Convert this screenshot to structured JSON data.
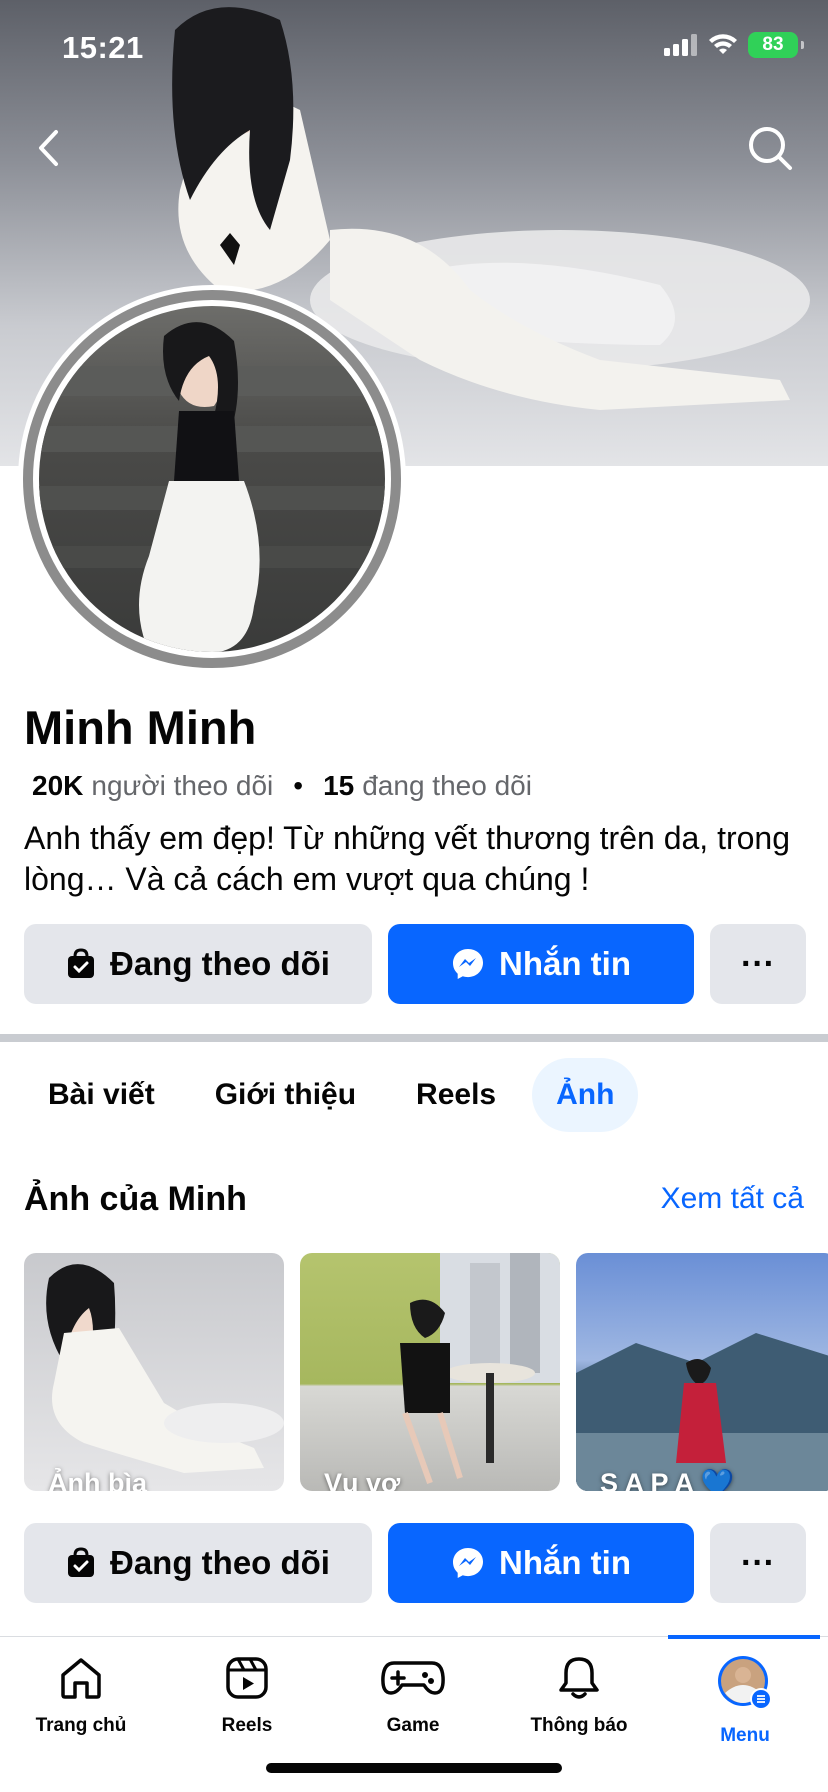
{
  "status_bar": {
    "time": "15:21",
    "battery": "83"
  },
  "header": {
    "back_icon": "chevron-left-icon",
    "search_icon": "search-icon"
  },
  "profile": {
    "name": "Minh Minh",
    "followers_count": "20K",
    "followers_label": "người theo dõi",
    "following_count": "15",
    "following_label": "đang theo dõi",
    "bio": "Anh thấy em đẹp! Từ những vết thương trên da, trong lòng… Và cả cách em vượt qua chúng !"
  },
  "actions": {
    "follow_label": "Đang theo dõi",
    "message_label": "Nhắn tin",
    "more_label": "···"
  },
  "tabs": [
    {
      "label": "Bài viết",
      "active": false
    },
    {
      "label": "Giới thiệu",
      "active": false
    },
    {
      "label": "Reels",
      "active": false
    },
    {
      "label": "Ảnh",
      "active": true
    }
  ],
  "photos": {
    "title": "Ảnh của Minh",
    "see_all": "Xem tất cả",
    "albums": [
      {
        "caption": "Ảnh bìa"
      },
      {
        "caption": "Vụ vợ"
      },
      {
        "caption": "S A P A 💙"
      }
    ]
  },
  "bottom_nav": [
    {
      "label": "Trang chủ",
      "icon": "home-icon",
      "active": false
    },
    {
      "label": "Reels",
      "icon": "reels-icon",
      "active": false
    },
    {
      "label": "Game",
      "icon": "game-icon",
      "active": false
    },
    {
      "label": "Thông báo",
      "icon": "bell-icon",
      "active": false
    },
    {
      "label": "Menu",
      "icon": "avatar-menu-icon",
      "active": true
    }
  ],
  "colors": {
    "primary": "#0866ff",
    "button_gray": "#e4e6eb",
    "text": "#050505",
    "secondary_text": "#65676b"
  }
}
